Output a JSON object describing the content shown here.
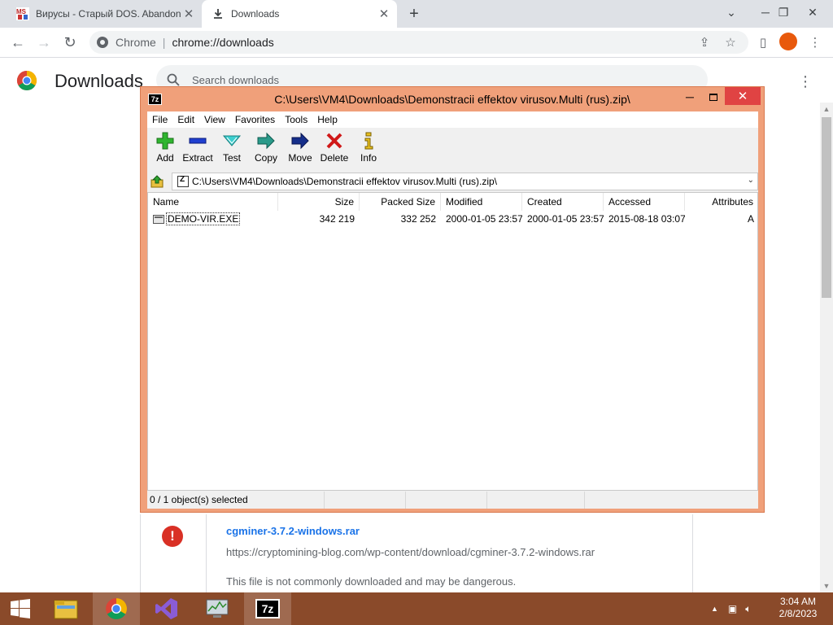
{
  "browser": {
    "tabs": [
      {
        "title": "Вирусы - Старый DOS. Abandonware",
        "favicon_text": "MS"
      },
      {
        "title": "Downloads"
      }
    ],
    "new_tab_symbol": "+",
    "omnibox": {
      "chip": "Chrome",
      "url": "chrome://downloads"
    }
  },
  "downloads_page": {
    "title": "Downloads",
    "search_placeholder": "Search downloads",
    "item": {
      "filename": "cgminer-3.7.2-windows.rar",
      "url": "https://cryptomining-blog.com/wp-content/download/cgminer-3.7.2-windows.rar",
      "warning": "This file is not commonly downloaded and may be dangerous.",
      "warning_symbol": "!"
    }
  },
  "sevenzip": {
    "icon_text": "7z",
    "title": "C:\\Users\\VM4\\Downloads\\Demonstracii effektov virusov.Multi (rus).zip\\",
    "menu": [
      "File",
      "Edit",
      "View",
      "Favorites",
      "Tools",
      "Help"
    ],
    "toolbar": {
      "add": "Add",
      "extract": "Extract",
      "test": "Test",
      "copy": "Copy",
      "move": "Move",
      "delete": "Delete",
      "info": "Info"
    },
    "path": "C:\\Users\\VM4\\Downloads\\Demonstracii effektov virusov.Multi (rus).zip\\",
    "columns": [
      "Name",
      "Size",
      "Packed Size",
      "Modified",
      "Created",
      "Accessed",
      "Attributes"
    ],
    "rows": [
      {
        "name": "DEMO-VIR.EXE",
        "size": "342 219",
        "packed": "332 252",
        "modified": "2000-01-05 23:57",
        "created": "2000-01-05 23:57",
        "accessed": "2015-08-18 03:07",
        "attributes": "A"
      }
    ],
    "status": "0 / 1 object(s) selected"
  },
  "taskbar": {
    "time": "3:04 AM",
    "date": "2/8/2023",
    "apps": [
      "start",
      "file-explorer",
      "chrome",
      "visual-studio",
      "task-manager",
      "7-zip"
    ],
    "active_app_text": "7z"
  },
  "colors": {
    "window_frame": "#f0a07a",
    "taskbar": "#8a4a2a",
    "link": "#1a73e8",
    "danger": "#d93025"
  }
}
